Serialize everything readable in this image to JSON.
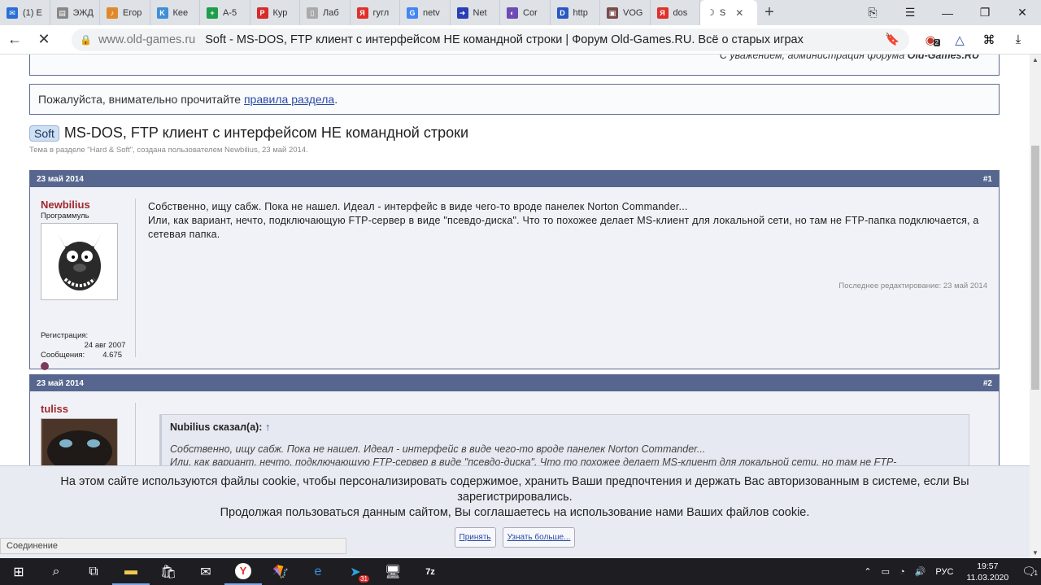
{
  "browser": {
    "tabs": [
      {
        "label": "(1) E",
        "color": "#2b6fd6",
        "glyph": "✉"
      },
      {
        "label": "ЭЖД",
        "color": "#888888",
        "glyph": "▤"
      },
      {
        "label": "Егор",
        "color": "#e0892b",
        "glyph": "♪"
      },
      {
        "label": "Кее",
        "color": "#3f8fd6",
        "glyph": "K"
      },
      {
        "label": "А-5",
        "color": "#1e9d4b",
        "glyph": "+"
      },
      {
        "label": "Кур",
        "color": "#d62b2b",
        "glyph": "P"
      },
      {
        "label": "Лаб",
        "color": "#aaaaaa",
        "glyph": "▯"
      },
      {
        "label": "гугл",
        "color": "#e0302b",
        "glyph": "Я"
      },
      {
        "label": "netv",
        "color": "#4285f4",
        "glyph": "G"
      },
      {
        "label": "Net",
        "color": "#2a3fb5",
        "glyph": "➜"
      },
      {
        "label": "Cor",
        "color": "#6c4bb5",
        "glyph": "◐"
      },
      {
        "label": "http",
        "color": "#2a58c2",
        "glyph": "D"
      },
      {
        "label": "VOG",
        "color": "#7a4b4b",
        "glyph": "▣"
      },
      {
        "label": "dos",
        "color": "#e0302b",
        "glyph": "Я"
      }
    ],
    "active_tab": {
      "label": "S",
      "glyph": "☽"
    },
    "url_domain": "www.old-games.ru",
    "url_title": "Soft - MS-DOS, FTP клиент с интерфейсом НЕ командной строки | Форум Old-Games.RU. Всё о старых играх",
    "ext_badge": "2"
  },
  "forum": {
    "signature_prefix": "С уважением, администрация форума ",
    "signature_site": "Old-Games.RU",
    "rules_prefix": "Пожалуйста, внимательно прочитайте ",
    "rules_link": "правила раздела",
    "rules_suffix": ".",
    "thread_prefix": "Soft",
    "thread_title": "MS-DOS, FTP клиент с интерфейсом НЕ командной строки",
    "thread_meta": "Тема в разделе \"Hard & Soft\", создана пользователем Newbilius, 23 май 2014.",
    "post1": {
      "date": "23 май 2014",
      "num": "#1",
      "username": "Newbilius",
      "user_title": "Программуль",
      "reg_label": "Регистрация:",
      "reg_date": "24 авг 2007",
      "msgs_label": "Сообщения:",
      "msgs_count": "4.675",
      "text_line1": "Собственно, ищу сабж. Пока не нашел. Идеал - интерфейс в виде чего-то вроде панелек Norton Commander...",
      "text_line2": "Или, как вариант, нечто, подключающую FTP-сервер в виде \"псевдо-диска\". Что то похожее делает MS-клиент для локальной сети, но там не FTP-папка подключается, а сетевая папка.",
      "last_edit": "Последнее редактирование: 23 май 2014"
    },
    "post2": {
      "date": "23 май 2014",
      "num": "#2",
      "username": "tuliss",
      "quote_author": "Nubilius сказал(а):",
      "quote_arrow": "↑",
      "quote_line1": "Собственно, ищу сабж. Пока не нашел. Идеал - интерфейс в виде чего-то вроде панелек Norton Commander...",
      "quote_line2": "Или, как вариант, нечто, подключающую FTP-сервер в виде \"псевдо-диска\". Что то похожее делает MS-клиент для локальной сети, но там не FTP-"
    }
  },
  "cookie": {
    "line1": "На этом сайте используются файлы cookie, чтобы персонализировать содержимое, хранить Ваши предпочтения и держать Вас авторизованным в системе, если Вы",
    "line2": "зарегистрировались.",
    "line3": "Продолжая пользоваться данным сайтом, Вы соглашаетесь на использование нами Ваших файлов cookie.",
    "accept": "Принять",
    "more": "Узнать больше..."
  },
  "status_text": "Соединение",
  "taskbar": {
    "lang": "РУС",
    "time": "19:57",
    "date": "11.03.2020",
    "notif_count": "1",
    "telegram_badge": "31"
  }
}
